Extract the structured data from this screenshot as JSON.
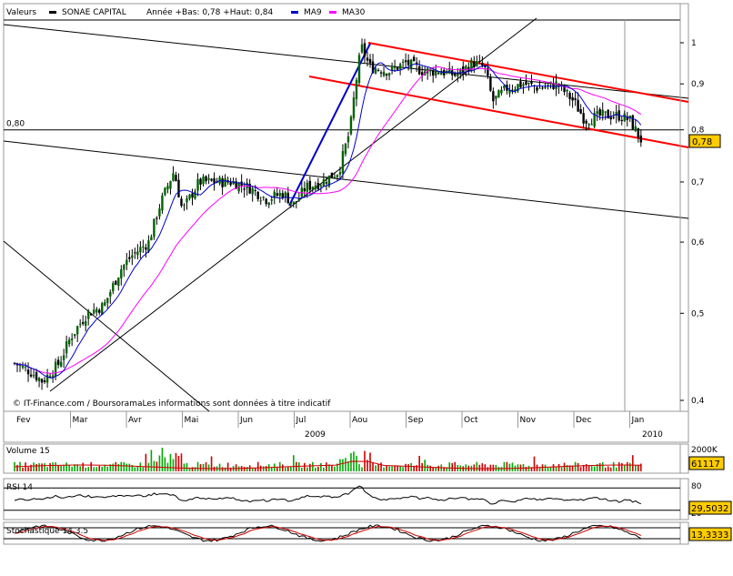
{
  "header": {
    "label": "Valeurs",
    "instrument": "SONAE CAPITAL",
    "info": "Année +Bas: 0,78 +Haut: 0,84",
    "ma9_label": "MA9",
    "ma30_label": "MA30"
  },
  "copyright": "© IT-Finance.com / BoursoramaLes informations sont données à titre indicatif",
  "colors": {
    "candle_up": "#006400",
    "candle_down": "#000000",
    "ma9": "#0000cc",
    "ma30": "#ff00ff",
    "channel": "#ff0000",
    "trendline": "#000000",
    "tag_fill": "#ffcc00",
    "volume_up": "#00aa00",
    "volume_down": "#cc0000",
    "rsi": "#000000",
    "stoch_k": "#000000",
    "stoch_d": "#cc0000"
  },
  "chart_data": [
    {
      "type": "candlestick",
      "panel": "price",
      "x_tick_labels": [
        "Fev",
        "Mar",
        "Avr",
        "Mai",
        "Jun",
        "Jul",
        "Aou",
        "Sep",
        "Oct",
        "Nov",
        "Dec",
        "Jan"
      ],
      "year_labels": [
        "2009",
        "2010"
      ],
      "y_tick_labels": [
        "1",
        "0,9",
        "0,8",
        "0,7",
        "0,6",
        "0,5",
        "0,4"
      ],
      "y_ticks": [
        1.0,
        0.9,
        0.8,
        0.7,
        0.6,
        0.5,
        0.4
      ],
      "ylim": [
        0.39,
        1.1
      ],
      "scale": "log",
      "reference_line": {
        "value": 0.8,
        "label": "0,80"
      },
      "last_value": {
        "value": 0.78,
        "label": "0,78"
      },
      "close_path": [
        {
          "m": 0.0,
          "v": 0.44
        },
        {
          "m": 0.3,
          "v": 0.43
        },
        {
          "m": 0.5,
          "v": 0.42
        },
        {
          "m": 0.8,
          "v": 0.44
        },
        {
          "m": 1.0,
          "v": 0.47
        },
        {
          "m": 1.3,
          "v": 0.5
        },
        {
          "m": 1.6,
          "v": 0.51
        },
        {
          "m": 1.9,
          "v": 0.56
        },
        {
          "m": 2.1,
          "v": 0.58
        },
        {
          "m": 2.4,
          "v": 0.6
        },
        {
          "m": 2.6,
          "v": 0.66
        },
        {
          "m": 2.85,
          "v": 0.72
        },
        {
          "m": 3.0,
          "v": 0.65
        },
        {
          "m": 3.3,
          "v": 0.7
        },
        {
          "m": 3.6,
          "v": 0.7
        },
        {
          "m": 3.9,
          "v": 0.7
        },
        {
          "m": 4.2,
          "v": 0.69
        },
        {
          "m": 4.5,
          "v": 0.67
        },
        {
          "m": 4.8,
          "v": 0.68
        },
        {
          "m": 5.0,
          "v": 0.66
        },
        {
          "m": 5.2,
          "v": 0.69
        },
        {
          "m": 5.5,
          "v": 0.7
        },
        {
          "m": 5.8,
          "v": 0.72
        },
        {
          "m": 6.0,
          "v": 0.8
        },
        {
          "m": 6.1,
          "v": 0.9
        },
        {
          "m": 6.2,
          "v": 0.99
        },
        {
          "m": 6.35,
          "v": 0.94
        },
        {
          "m": 6.7,
          "v": 0.93
        },
        {
          "m": 7.0,
          "v": 0.95
        },
        {
          "m": 7.3,
          "v": 0.93
        },
        {
          "m": 7.6,
          "v": 0.93
        },
        {
          "m": 7.9,
          "v": 0.92
        },
        {
          "m": 8.2,
          "v": 0.95
        },
        {
          "m": 8.4,
          "v": 0.94
        },
        {
          "m": 8.55,
          "v": 0.86
        },
        {
          "m": 8.8,
          "v": 0.89
        },
        {
          "m": 9.1,
          "v": 0.9
        },
        {
          "m": 9.4,
          "v": 0.89
        },
        {
          "m": 9.7,
          "v": 0.9
        },
        {
          "m": 10.0,
          "v": 0.86
        },
        {
          "m": 10.2,
          "v": 0.82
        },
        {
          "m": 10.5,
          "v": 0.83
        },
        {
          "m": 10.8,
          "v": 0.83
        },
        {
          "m": 11.0,
          "v": 0.82
        },
        {
          "m": 11.1,
          "v": 0.8
        },
        {
          "m": 11.2,
          "v": 0.78
        }
      ]
    },
    {
      "type": "bar",
      "panel": "volume",
      "title": "Volume 15",
      "y_tick_labels": [
        "2000K",
        "1000K"
      ],
      "last_value": {
        "value": 61117,
        "label": "61117"
      }
    },
    {
      "type": "line",
      "panel": "rsi",
      "title": "RSI 14",
      "y_tick_labels": [
        "80",
        "20"
      ],
      "last_value": {
        "value": 29.5032,
        "label": "29,5032"
      }
    },
    {
      "type": "line",
      "panel": "stochastic",
      "title": "Stochastique 14.3.5",
      "last_value": {
        "value": 13.3333,
        "label": "13,3333"
      }
    }
  ]
}
